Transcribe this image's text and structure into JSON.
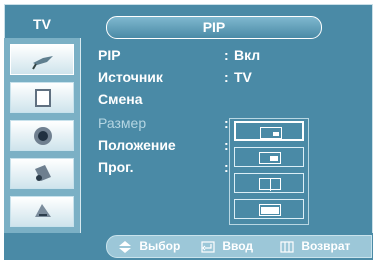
{
  "header": {
    "left_tab": "TV",
    "right_tab": "PIP"
  },
  "sidebar": {
    "items": [
      {
        "icon": "antenna-icon"
      },
      {
        "icon": "screen-icon"
      },
      {
        "icon": "speaker-icon"
      },
      {
        "icon": "satellite-icon"
      },
      {
        "icon": "settings-icon"
      }
    ]
  },
  "menu": {
    "rows": [
      {
        "label": "PIP",
        "value": "Вкл"
      },
      {
        "label": "Источник",
        "value": "TV"
      },
      {
        "label": "Смена",
        "value": ""
      },
      {
        "label": "Размер",
        "value": ""
      },
      {
        "label": "Положение",
        "value": ""
      },
      {
        "label": "Прог.",
        "value": ""
      }
    ],
    "colon": ":"
  },
  "dropdown": {
    "selected_index": 0,
    "options": [
      {
        "icon": "pip-small-icon"
      },
      {
        "icon": "pip-medium-icon"
      },
      {
        "icon": "pip-split-icon"
      },
      {
        "icon": "pip-double-icon"
      }
    ]
  },
  "bottom": {
    "select": "Выбор",
    "enter": "Ввод",
    "back": "Возврат"
  }
}
